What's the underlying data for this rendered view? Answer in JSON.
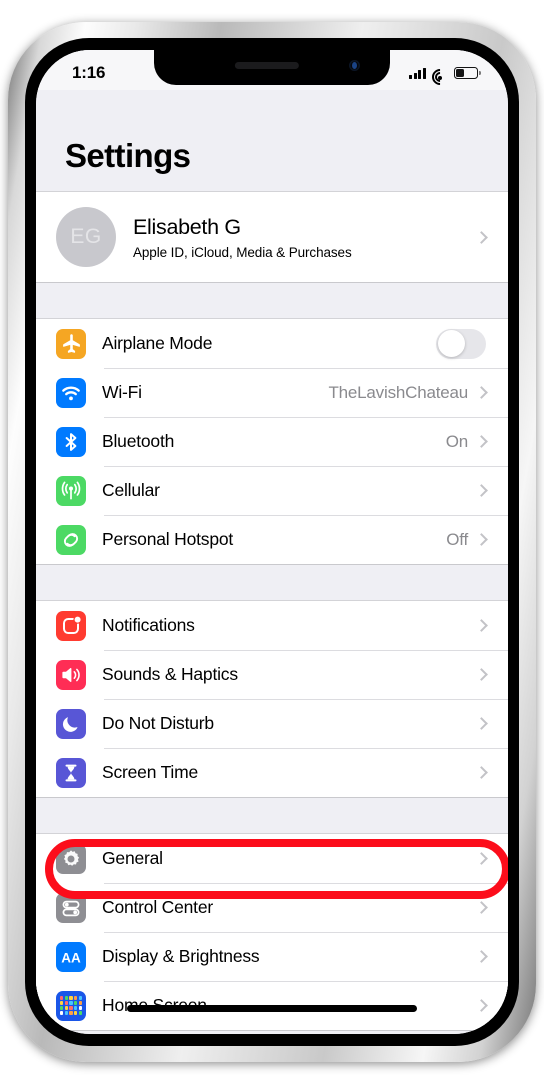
{
  "status_bar": {
    "time": "1:16",
    "signal_icon": "cellular-signal-icon",
    "wifi_icon": "wifi-icon",
    "battery_icon": "battery-icon"
  },
  "header": {
    "title": "Settings"
  },
  "account": {
    "initials": "EG",
    "name": "Elisabeth G",
    "subtitle": "Apple ID, iCloud, Media & Purchases"
  },
  "groups": [
    {
      "rows": [
        {
          "label": "Airplane Mode",
          "value": "",
          "icon": "airplane-icon",
          "color": "#f5a623",
          "control": "toggle",
          "toggle_on": false
        },
        {
          "label": "Wi-Fi",
          "value": "TheLavishChateau",
          "icon": "wifi-icon",
          "color": "#007aff",
          "control": "chevron"
        },
        {
          "label": "Bluetooth",
          "value": "On",
          "icon": "bluetooth-icon",
          "color": "#007aff",
          "control": "chevron"
        },
        {
          "label": "Cellular",
          "value": "",
          "icon": "cellular-antenna-icon",
          "color": "#4cd964",
          "control": "chevron"
        },
        {
          "label": "Personal Hotspot",
          "value": "Off",
          "icon": "hotspot-icon",
          "color": "#4cd964",
          "control": "chevron"
        }
      ]
    },
    {
      "rows": [
        {
          "label": "Notifications",
          "value": "",
          "icon": "notifications-icon",
          "color": "#ff3b30",
          "control": "chevron"
        },
        {
          "label": "Sounds & Haptics",
          "value": "",
          "icon": "speaker-icon",
          "color": "#ff2d55",
          "control": "chevron"
        },
        {
          "label": "Do Not Disturb",
          "value": "",
          "icon": "moon-icon",
          "color": "#5856d6",
          "control": "chevron"
        },
        {
          "label": "Screen Time",
          "value": "",
          "icon": "hourglass-icon",
          "color": "#5856d6",
          "control": "chevron"
        }
      ]
    },
    {
      "rows": [
        {
          "label": "General",
          "value": "",
          "icon": "gear-icon",
          "color": "#8e8e93",
          "control": "chevron",
          "highlighted": true
        },
        {
          "label": "Control Center",
          "value": "",
          "icon": "toggles-icon",
          "color": "#8e8e93",
          "control": "chevron"
        },
        {
          "label": "Display & Brightness",
          "value": "",
          "icon": "aa-text-icon",
          "color": "#007aff",
          "control": "chevron"
        },
        {
          "label": "Home Screen",
          "value": "",
          "icon": "home-screen-grid-icon",
          "color": "#1a56e8",
          "control": "chevron"
        }
      ]
    }
  ],
  "annotation": {
    "highlight_color": "#fc0d1b",
    "target": "General"
  }
}
